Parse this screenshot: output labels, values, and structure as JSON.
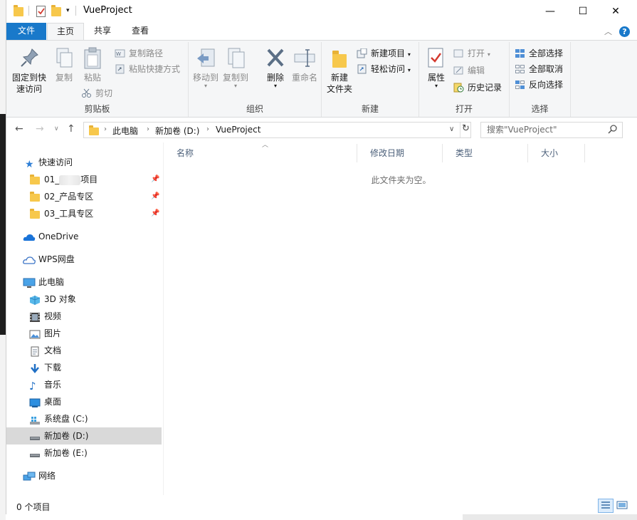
{
  "window": {
    "title": "VueProject",
    "minimize": "—",
    "maximize": "☐",
    "close": "✕"
  },
  "ribbon_tabs": {
    "file": "文件",
    "home": "主页",
    "share": "共享",
    "view": "查看"
  },
  "ribbon": {
    "clipboard": {
      "label": "剪贴板",
      "pin_quick_access": [
        "固定到快",
        "速访问"
      ],
      "copy": "复制",
      "paste": "粘贴",
      "copy_path": "复制路径",
      "paste_shortcut": "粘贴快捷方式",
      "cut": "剪切"
    },
    "organize": {
      "label": "组织",
      "move_to": "移动到",
      "copy_to": "复制到",
      "delete": "删除",
      "rename": "重命名"
    },
    "new": {
      "label": "新建",
      "new_folder": [
        "新建",
        "文件夹"
      ],
      "new_item": "新建项目",
      "easy_access": "轻松访问"
    },
    "open": {
      "label": "打开",
      "properties": "属性",
      "open": "打开",
      "edit": "编辑",
      "history": "历史记录"
    },
    "select": {
      "label": "选择",
      "select_all": "全部选择",
      "select_none": "全部取消",
      "invert": "反向选择"
    }
  },
  "address": {
    "crumbs": [
      "此电脑",
      "新加卷 (D:)",
      "VueProject"
    ],
    "search_placeholder": "搜索\"VueProject\""
  },
  "nav": {
    "quick_access": "快速访问",
    "qa_items": [
      "01_",
      "项目",
      "02_产品专区",
      "03_工具专区"
    ],
    "onedrive": "OneDrive",
    "wps": "WPS网盘",
    "this_pc": "此电脑",
    "pc_items": [
      "3D 对象",
      "视频",
      "图片",
      "文档",
      "下载",
      "音乐",
      "桌面",
      "系统盘 (C:)",
      "新加卷 (D:)",
      "新加卷 (E:)"
    ],
    "network": "网络"
  },
  "columns": [
    "名称",
    "修改日期",
    "类型",
    "大小"
  ],
  "empty_message": "此文件夹为空。",
  "status": {
    "count": "0 个项目"
  },
  "colors": {
    "file_tab": "#1979ca",
    "folder": "#f7c84c",
    "selection": "#d9d9d9"
  }
}
